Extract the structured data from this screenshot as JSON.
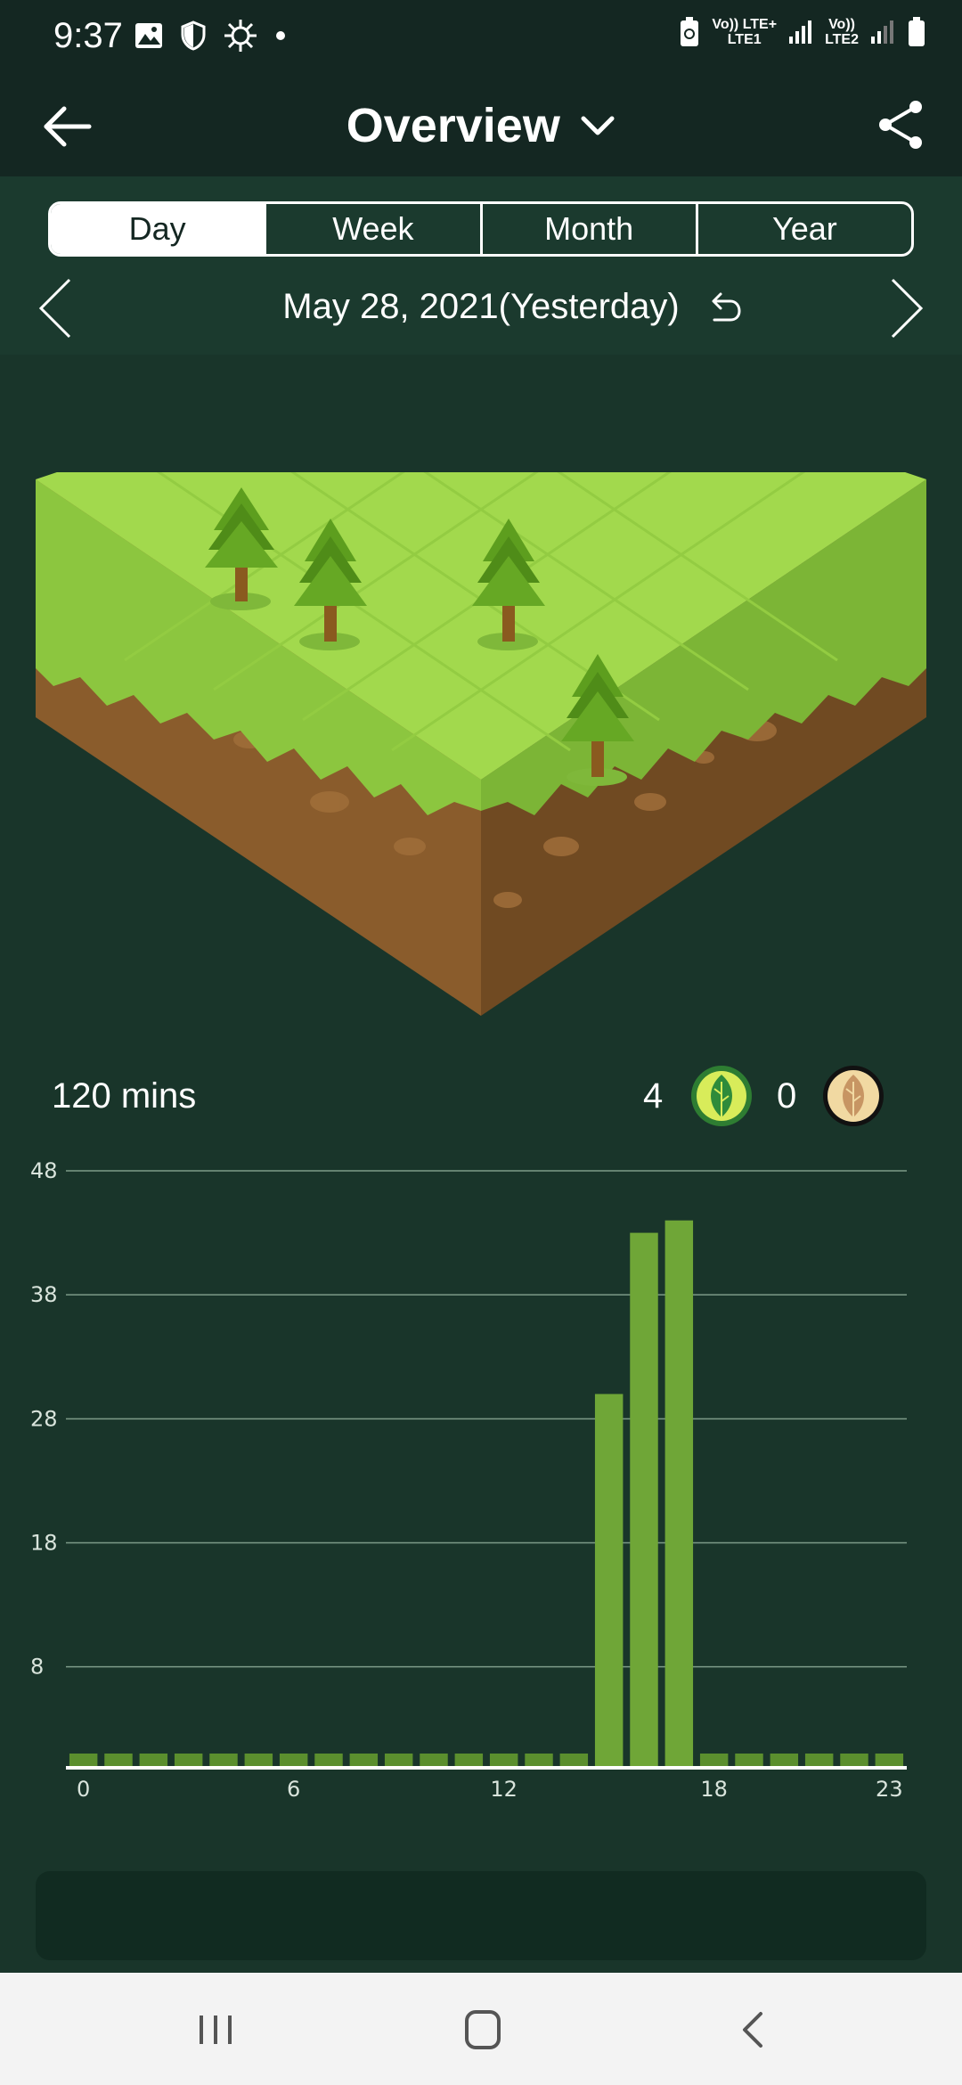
{
  "status_bar": {
    "time": "9:37",
    "sim1_top": "Vo)) LTE+",
    "sim1_bottom": "LTE1",
    "sim2_top": "Vo))",
    "sim2_bottom": "LTE2"
  },
  "header": {
    "title": "Overview"
  },
  "tabs": [
    {
      "label": "Day",
      "active": true
    },
    {
      "label": "Week",
      "active": false
    },
    {
      "label": "Month",
      "active": false
    },
    {
      "label": "Year",
      "active": false
    }
  ],
  "date_nav": {
    "label": "May 28, 2021(Yesterday)"
  },
  "stats": {
    "total": "120 mins",
    "success_count": "4",
    "fail_count": "0"
  },
  "colors": {
    "background": "#19352a",
    "header": "#142722",
    "bar": "#6fa637",
    "grass": "#9ed646"
  },
  "chart_data": {
    "type": "bar",
    "x": [
      0,
      1,
      2,
      3,
      4,
      5,
      6,
      7,
      8,
      9,
      10,
      11,
      12,
      13,
      14,
      15,
      16,
      17,
      18,
      19,
      20,
      21,
      22,
      23
    ],
    "values": [
      0,
      0,
      0,
      0,
      0,
      0,
      0,
      0,
      0,
      0,
      0,
      0,
      0,
      0,
      0,
      30,
      43,
      44,
      0,
      0,
      0,
      0,
      0,
      0
    ],
    "x_tick_labels": [
      "0",
      "6",
      "12",
      "18",
      "23"
    ],
    "y_tick_labels": [
      "48",
      "38",
      "28",
      "18",
      "8"
    ],
    "y_ticks": [
      48,
      38,
      28,
      18,
      8
    ],
    "ylim": [
      0,
      48
    ],
    "grid": true
  }
}
